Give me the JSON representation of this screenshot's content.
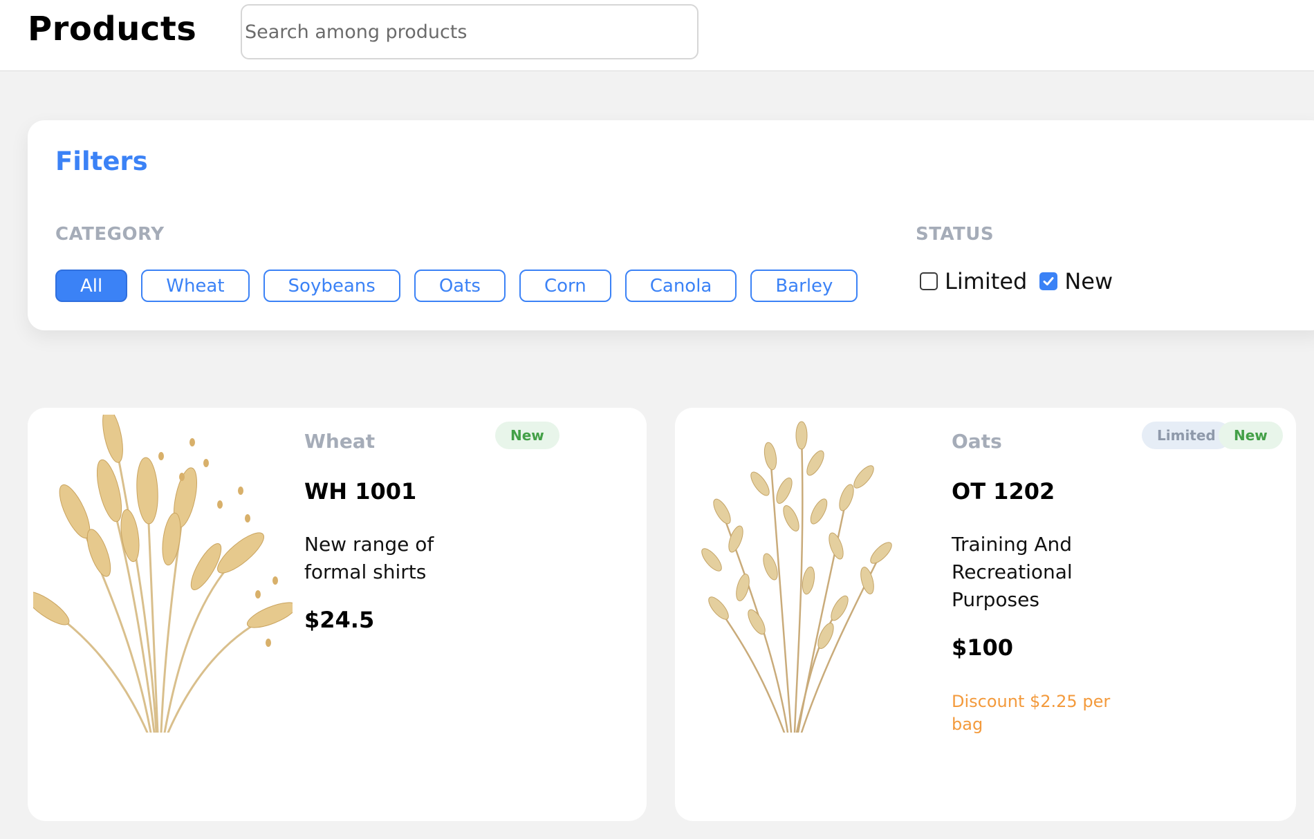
{
  "header": {
    "title": "Products",
    "search_placeholder": "Search among products"
  },
  "filters": {
    "title": "Filters",
    "category_label": "CATEGORY",
    "categories": [
      "All",
      "Wheat",
      "Soybeans",
      "Oats",
      "Corn",
      "Canola",
      "Barley"
    ],
    "selected_category": "All",
    "status_label": "STATUS",
    "status_options": [
      {
        "label": "Limited",
        "checked": false
      },
      {
        "label": "New",
        "checked": true
      }
    ]
  },
  "products": [
    {
      "category": "Wheat",
      "code": "WH 1001",
      "description": "New range of formal shirts",
      "price": "$24.5",
      "badges": [
        "New"
      ],
      "discount": "",
      "image": "wheat-ears-image"
    },
    {
      "category": "Oats",
      "code": "OT 1202",
      "description": "Training And Recreational Purposes",
      "price": "$100",
      "badges": [
        "Limited",
        "New"
      ],
      "discount": "Discount $2.25 per bag",
      "image": "oat-stalks-image"
    }
  ],
  "colors": {
    "accent": "#3b82f6",
    "new_badge_text": "#43a047",
    "new_badge_bg": "#e8f5ea",
    "limited_badge_text": "#8e99aa",
    "limited_badge_bg": "#e6edf6",
    "discount": "#f39a3c",
    "muted_label": "#a5acb8"
  }
}
